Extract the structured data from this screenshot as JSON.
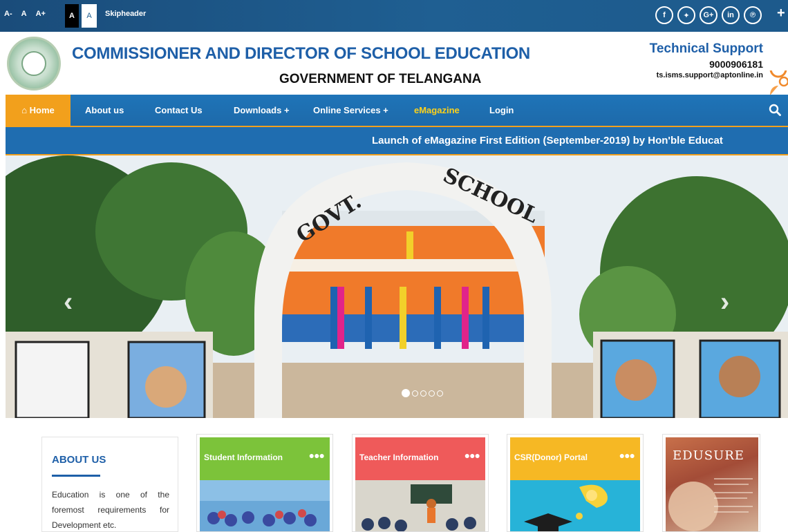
{
  "topbar": {
    "font_small": "A-",
    "font_normal": "A",
    "font_large": "A+",
    "contrast_dark": "A",
    "contrast_light": "A",
    "skip": "Skipheader",
    "social": [
      {
        "name": "facebook-icon",
        "glyph": "f"
      },
      {
        "name": "twitter-icon",
        "glyph": "✦"
      },
      {
        "name": "google-plus-icon",
        "glyph": "G+"
      },
      {
        "name": "linkedin-icon",
        "glyph": "in"
      },
      {
        "name": "pinterest-icon",
        "glyph": "℗"
      }
    ],
    "plus": "+"
  },
  "header": {
    "title": "COMMISSIONER AND DIRECTOR OF SCHOOL EDUCATION",
    "subtitle": "GOVERNMENT OF TELANGANA",
    "support_title": "Technical Support",
    "support_phone": "9000906181",
    "support_email": "ts.isms.support@aptonline.in"
  },
  "nav": {
    "home": "⌂ Home",
    "about": "About us",
    "contact": "Contact Us",
    "downloads": "Downloads +",
    "online": "Online Services +",
    "emagazine": "eMagazine",
    "login": "Login"
  },
  "marquee": {
    "text": "Launch of eMagazine First Edition (September-2019) by Hon'ble Educat"
  },
  "slider": {
    "prev": "‹",
    "next": "›",
    "dot_count": 5,
    "active_dot": 1
  },
  "about": {
    "title": "ABOUT US",
    "text": "Education is one of the foremost requirements for Development etc."
  },
  "tiles": [
    {
      "title": "Student Information",
      "more": "●●●",
      "color": "#7cc33a"
    },
    {
      "title": "Teacher Information",
      "more": "●●●",
      "color": "#ef5a5a"
    },
    {
      "title": "CSR(Donor) Portal",
      "more": "●●●",
      "color": "#f6b824"
    }
  ],
  "edusure": {
    "title": "EDUSURE"
  },
  "colors": {
    "brand_blue": "#1e5fa8",
    "nav_blue": "#1f74b8",
    "accent_orange": "#f2a01c",
    "emagazine_yellow": "#ffd21a"
  }
}
